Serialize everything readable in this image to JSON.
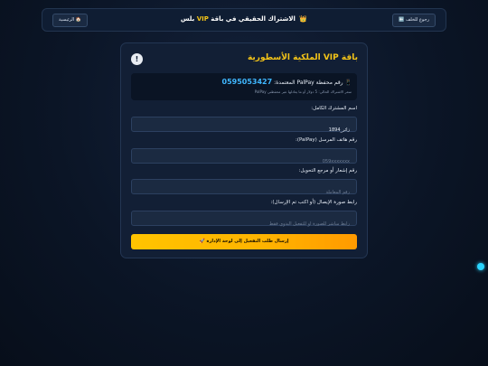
{
  "header": {
    "back_label": "رجوع للخلف ⬅️",
    "title_crown": "👑",
    "title_pre": "الاشتراك الحقيقي في باقة",
    "title_vip": "VIP",
    "title_post": "بلس",
    "home_label": "🏠 الرئيسية"
  },
  "card": {
    "title": "باقة VIP الملكية الأسطورية",
    "info_label": "!",
    "wallet": {
      "icon": "📱",
      "label": "رقم محفظة PalPay المعتمدة:",
      "number": "0595053427",
      "note": "سعر الاشتراك الحالي: 5 دولار أو ما يعادلها عبر محفظتي PalPay"
    },
    "fields": [
      {
        "label": "اسم المشترك الكامل:",
        "value": "زائر_1894",
        "placeholder": ""
      },
      {
        "label": "رقم هاتف المرسل (PalPay):",
        "value": "",
        "placeholder": "059xxxxxxx"
      },
      {
        "label": "رقم إشعار أو مرجع التحويل:",
        "value": "",
        "placeholder": "رقم المعاملة"
      },
      {
        "label": "رابط صورة الإيصال (أو اكتب تم الإرسال):",
        "value": "",
        "placeholder": "رابط مباشر للصورة أو للتفعيل اليدوي فقط"
      }
    ],
    "submit_label": "إرسال طلب التفعيل إلى لوحة الإدارة 🚀"
  },
  "colors": {
    "accent_gold": "#f5c518",
    "wallet_number": "#3fb7ff",
    "status_dot": "#2ad4ff"
  }
}
